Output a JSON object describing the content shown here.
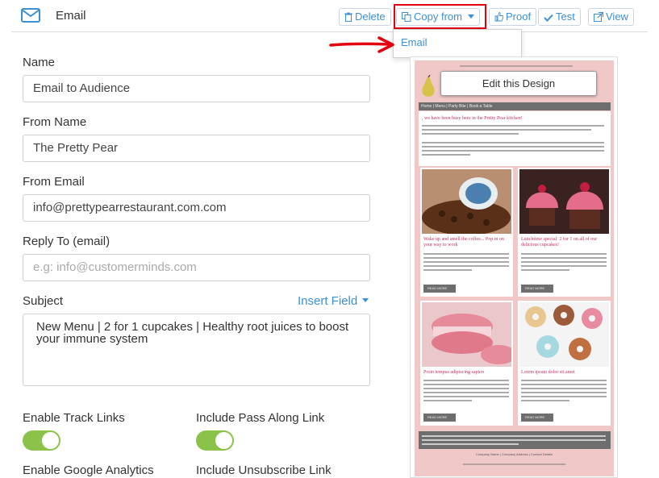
{
  "header": {
    "title": "Email",
    "buttons": {
      "delete": "Delete",
      "copy_from": "Copy from",
      "proof": "Proof",
      "test": "Test",
      "view": "View"
    },
    "copy_menu": [
      "Email"
    ]
  },
  "form": {
    "name_label": "Name",
    "name_value": "Email to Audience",
    "from_name_label": "From Name",
    "from_name_value": "The Pretty Pear",
    "from_email_label": "From Email",
    "from_email_value": "info@prettypearrestaurant.com.com",
    "reply_to_label": "Reply To (email)",
    "reply_to_placeholder": "e.g: info@customerminds.com",
    "subject_label": "Subject",
    "insert_field": "Insert Field",
    "subject_value": "New Menu | 2 for 1 cupcakes | Healthy root juices to boost your immune system",
    "enable_track_links": "Enable Track Links",
    "include_pass_along": "Include Pass Along Link",
    "enable_google_analytics": "Enable Google Analytics",
    "include_unsubscribe": "Include Unsubscribe Link",
    "track_links_on": true,
    "pass_along_on": true
  },
  "preview": {
    "edit_button": "Edit this Design",
    "nav": "Home | Menu | Party Bite | Book a Table",
    "headline": ", we have been busy bees in the Pretty Pear kitchen!",
    "card1_title": "Wake up and smell the coffee... Pop in on your way to work",
    "card2_title": "Lunchtime special: 2 for 1 on all of our delicious cupcakes!",
    "card3_title": "Proin tempus adipiscing sapien",
    "card4_title": "Lorem ipsum dolor sit amet",
    "read_more": "READ MORE",
    "footer_links": "Company Name | Company Address | Contact Details"
  },
  "colors": {
    "accent": "#3b8fd6",
    "toggle_on": "#8bc34a",
    "highlight": "#e3000f",
    "preview_bg": "#f0c8c8"
  }
}
